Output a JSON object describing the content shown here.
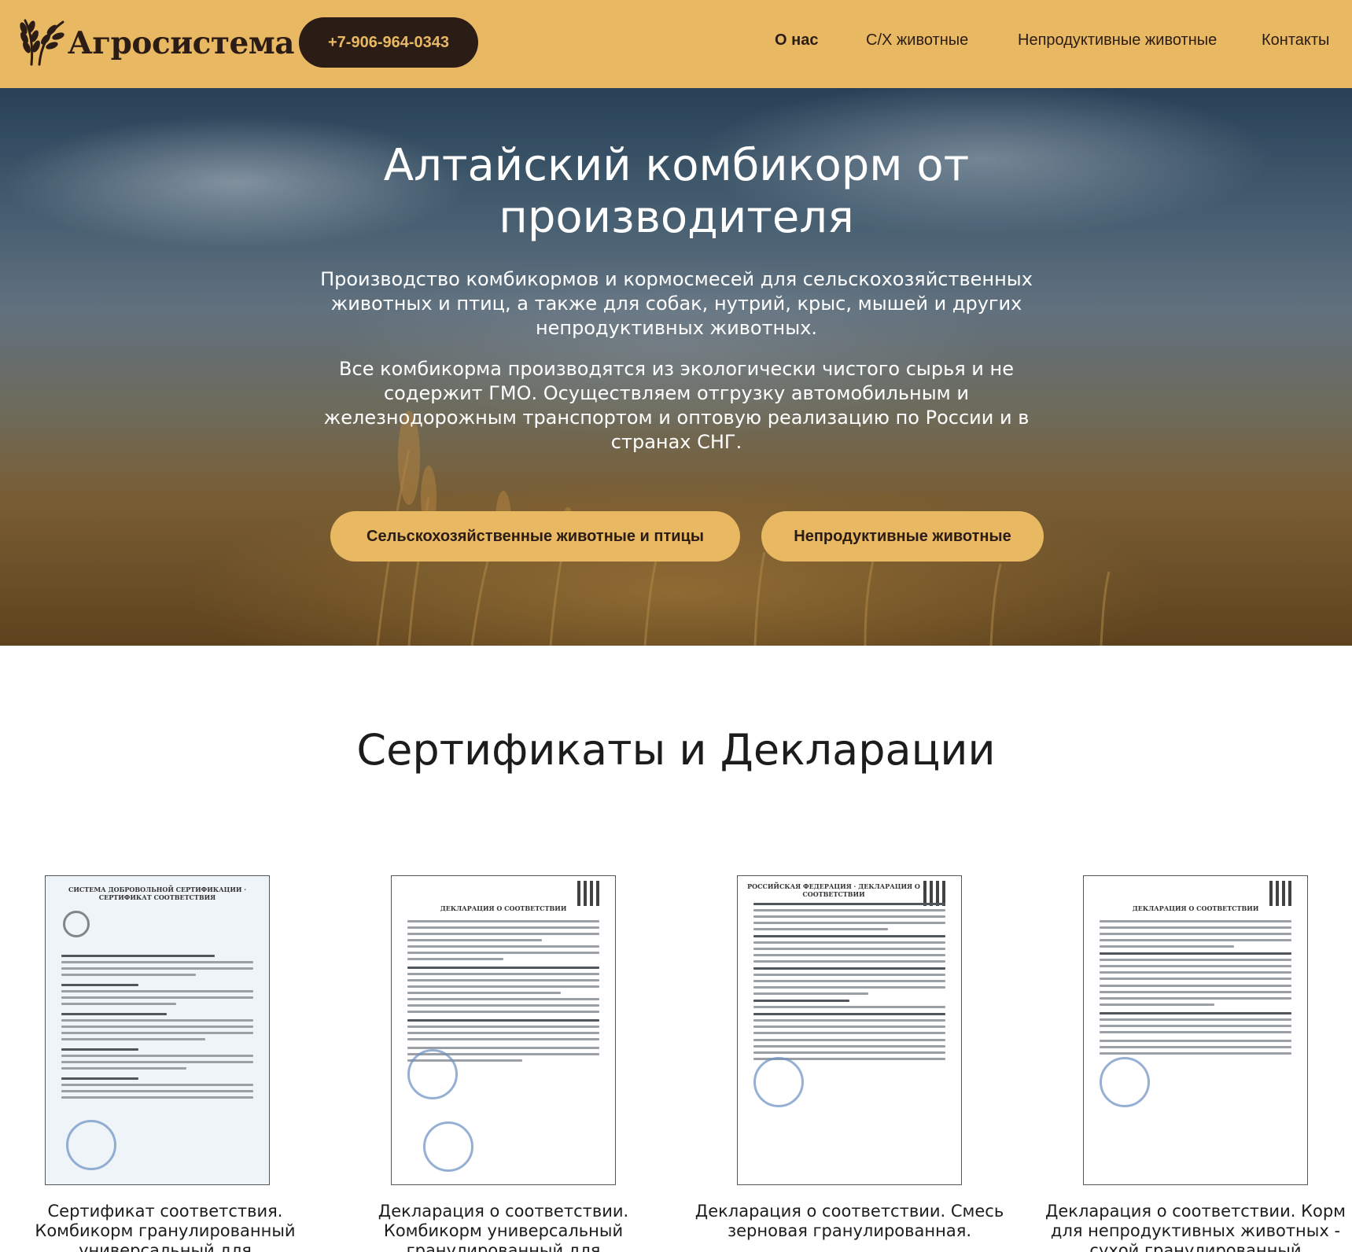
{
  "header": {
    "logo_text": "Агросистема",
    "logo_icon": "wheat-icon",
    "phone": "+7-906-964-0343",
    "nav": [
      "О нас",
      "С/Х животные",
      "Непродуктивные животные",
      "Контакты"
    ]
  },
  "hero": {
    "title": "Алтайский комбикорм от производителя",
    "paragraph_1": "Производство комбикормов и кормосмесей для сельскохозяйственных животных и птиц, а также для собак, нутрий, крыс, мышей и других непродуктивных животных.",
    "paragraph_2": "Все комбикорма производятся из экологически чистого сырья и не содержит ГМО. Осуществляем отгрузку автомобильным и железнодорожным транспортом и оптовую реализацию по России и в странах СНГ.",
    "button_1": "Сельскохозяйственные животные и птицы",
    "button_2": "Непродуктивные животные"
  },
  "certificates": {
    "title": "Сертификаты и Декларации",
    "items": [
      {
        "doc_heading": "СИСТЕМА ДОБРОВОЛЬНОЙ СЕРТИФИКАЦИИ · СЕРТИФИКАТ СООТВЕТСТВИЯ",
        "caption": "Сертификат соответствия. Комбикорм гранулированный универсальный для"
      },
      {
        "doc_heading": "ДЕКЛАРАЦИЯ О СООТВЕТСТВИИ",
        "caption": "Декларация о соответствии. Комбикорм универсальный гранулированный для"
      },
      {
        "doc_heading": "РОССИЙСКАЯ ФЕДЕРАЦИЯ · ДЕКЛАРАЦИЯ О СООТВЕТСТВИИ",
        "caption": "Декларация о соответствии. Смесь зерновая гранулированная."
      },
      {
        "doc_heading": "ДЕКЛАРАЦИЯ О СООТВЕТСТВИИ",
        "caption": "Декларация о соответствии. Корм для непродуктивных животных - сухой гранулированный"
      }
    ]
  },
  "colors": {
    "accent": "#e8b862",
    "dark": "#2b1d16"
  }
}
